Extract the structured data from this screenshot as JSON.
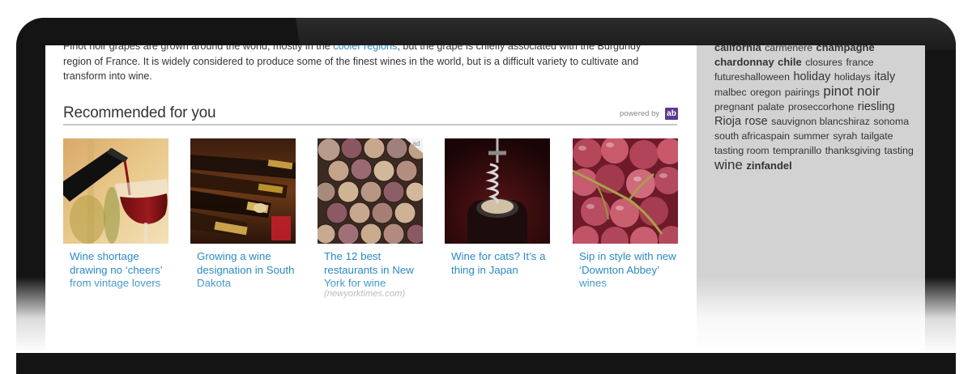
{
  "article": {
    "intro_before": "Pinot noir grapes are grown around the world, mostly in the ",
    "intro_link": "cooler regions",
    "intro_after": ", but the grape is chiefly associated with the Burgundy region of France. It is widely considered to produce some of the finest wines in the world, but is a difficult variety to cultivate and transform into wine."
  },
  "recommended": {
    "title": "Recommended for you",
    "powered_by": "powered by",
    "logo_text": "ab",
    "items": [
      {
        "title": "Wine shortage drawing no ‘cheers’ from vintage lovers",
        "source": "",
        "image": "pouring-wine-image"
      },
      {
        "title": "Growing a wine designation in South Dakota",
        "source": "",
        "image": "wine-bottles-image"
      },
      {
        "title": "The 12 best restaurants in New York for wine",
        "source": "(newyorktimes.com)",
        "ad_label": "ad",
        "image": "wine-corks-image"
      },
      {
        "title": "Wine for cats? It’s a thing in Japan",
        "source": "",
        "image": "corkscrew-image"
      },
      {
        "title": "Sip in style with new ‘Downton Abbey’ wines",
        "source": "",
        "image": "red-grapes-image"
      }
    ]
  },
  "sidebar": {
    "tags": [
      {
        "text": "california",
        "weight": "m"
      },
      {
        "text": "carmenere",
        "weight": "s"
      },
      {
        "text": "champagne",
        "weight": "m"
      },
      {
        "text": "chardonnay",
        "weight": "m"
      },
      {
        "text": "chile",
        "weight": "m"
      },
      {
        "text": "closures",
        "weight": "s"
      },
      {
        "text": "france",
        "weight": "s"
      },
      {
        "text": "futures",
        "weight": "s"
      },
      {
        "text": "halloween",
        "weight": "s"
      },
      {
        "text": "holiday",
        "weight": "l"
      },
      {
        "text": "holidays",
        "weight": "s"
      },
      {
        "text": "italy",
        "weight": "l"
      },
      {
        "text": "malbec",
        "weight": "s"
      },
      {
        "text": "oregon",
        "weight": "s"
      },
      {
        "text": "pairings",
        "weight": "s"
      },
      {
        "text": "pinot noir",
        "weight": "xl"
      },
      {
        "text": "pregnant",
        "weight": "s"
      },
      {
        "text": "palate",
        "weight": "s"
      },
      {
        "text": "prosecco",
        "weight": "s"
      },
      {
        "text": "rhone",
        "weight": "s"
      },
      {
        "text": "riesling",
        "weight": "l"
      },
      {
        "text": "Rioja",
        "weight": "l"
      },
      {
        "text": "rose",
        "weight": "l"
      },
      {
        "text": "sauvignon blanc",
        "weight": "s"
      },
      {
        "text": "shiraz",
        "weight": "s"
      },
      {
        "text": "sonoma",
        "weight": "s"
      },
      {
        "text": "south africa",
        "weight": "s"
      },
      {
        "text": "spain",
        "weight": "s"
      },
      {
        "text": "summer",
        "weight": "s"
      },
      {
        "text": "syrah",
        "weight": "s"
      },
      {
        "text": "tailgate",
        "weight": "s"
      },
      {
        "text": "tasting room",
        "weight": "s"
      },
      {
        "text": "tempranillo",
        "weight": "s"
      },
      {
        "text": "thanksgiving",
        "weight": "s"
      },
      {
        "text": "tasting",
        "weight": "s"
      },
      {
        "text": "wine",
        "weight": "xl"
      },
      {
        "text": "zinfandel",
        "weight": "m"
      }
    ]
  },
  "colors": {
    "link": "#2a8ac4",
    "frame": "#141414",
    "sidebar_bg": "#d2d2d2",
    "logo_bg": "#5e3a8e"
  }
}
